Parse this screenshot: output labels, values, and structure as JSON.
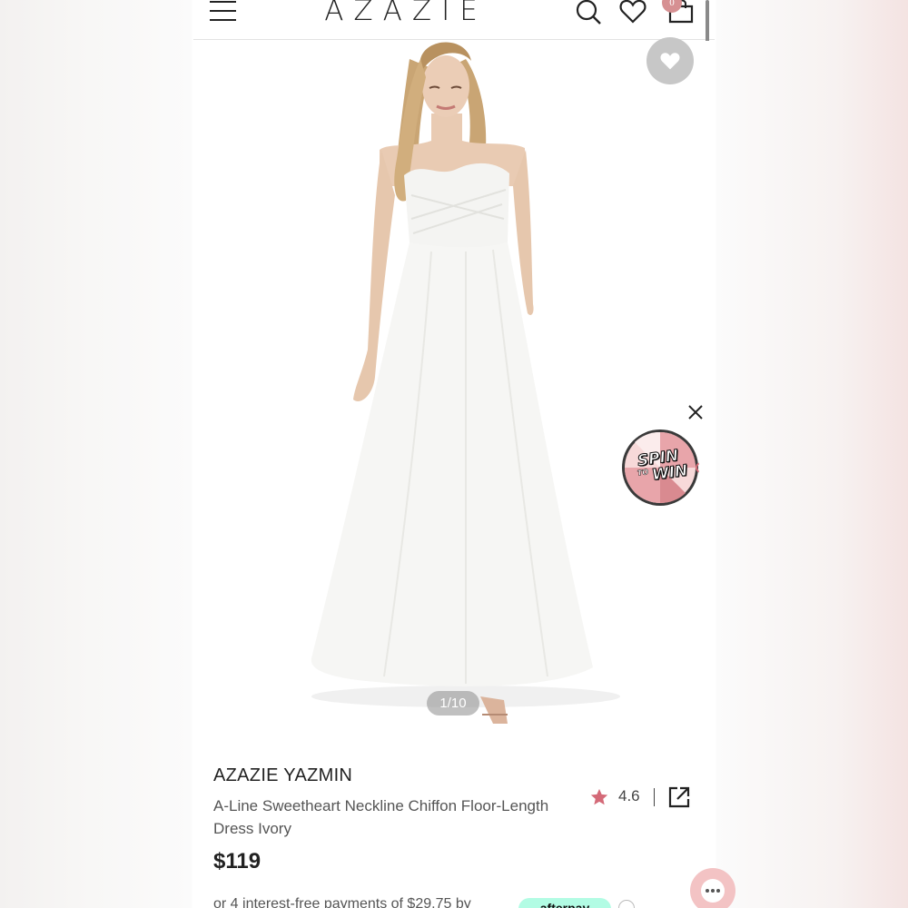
{
  "header": {
    "logo": "AZAZIE",
    "cart_count": "0"
  },
  "product": {
    "image_counter": "1/10",
    "brand": "AZAZIE YAZMIN",
    "description": "A-Line Sweetheart Neckline Chiffon Floor-Length Dress Ivory",
    "rating": "4.6",
    "price": "$119",
    "installments_text": "or 4 interest-free payments of $29.75 by",
    "afterpay_label": "afterpay"
  },
  "promo": {
    "spin_word": "SPIN",
    "to_word": "TO",
    "win_word": "WIN"
  },
  "colors": {
    "accent_pink": "#d69092",
    "afterpay_mint": "#b2fce4",
    "star": "#d46a78"
  },
  "icons": [
    "menu-icon",
    "search-icon",
    "heart-icon",
    "cart-icon",
    "close-icon",
    "star-icon",
    "share-icon",
    "info-icon",
    "chat-icon"
  ]
}
